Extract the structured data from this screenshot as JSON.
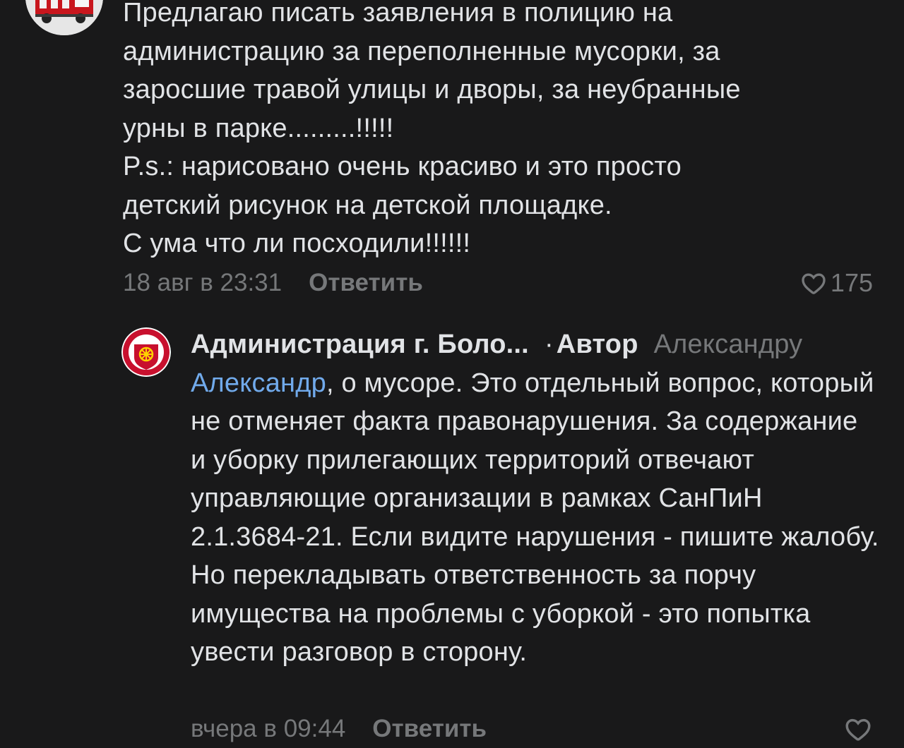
{
  "top_comment": {
    "text": "Предлагаю писать заявления в полицию на\nадминистрацию за переполненные мусорки, за\nзаросшие травой улицы и дворы, за неубранные\nурны в парке.........!!!!!\nP.s.: нарисовано очень красиво и это просто\nдетский рисунок на детской площадке.\nС ума что ли посходили!!!!!!",
    "date": "18 авг в 23:31",
    "reply_label": "Ответить",
    "likes": "175"
  },
  "reply": {
    "author_name": "Администрация г. Боло...",
    "separator": "·",
    "author_badge": "Автор",
    "reply_to": "Александру",
    "mention": "Александр",
    "text_after_mention": ", о мусоре. Это отдельный вопрос, который не отменяет факта правонарушения. За содержание и уборку прилегающих территорий отвечают управляющие организации в рамках СанПиН 2.1.3684-21. Если видите нарушения - пишите жалобу. Но перекладывать ответственность за порчу имущества на проблемы с уборкой - это попытка увести разговор в сторону.",
    "date": "вчера в 09:44",
    "reply_label": "Ответить"
  },
  "icons": {
    "like": "heart-icon",
    "top_avatar": "fire-truck-avatar-icon",
    "reply_avatar": "administration-emblem-icon"
  },
  "colors": {
    "background": "#19191a",
    "text": "#e1e3e6",
    "secondary": "#76787a",
    "link": "#71aaeb",
    "emblem_red": "#c8102e"
  }
}
